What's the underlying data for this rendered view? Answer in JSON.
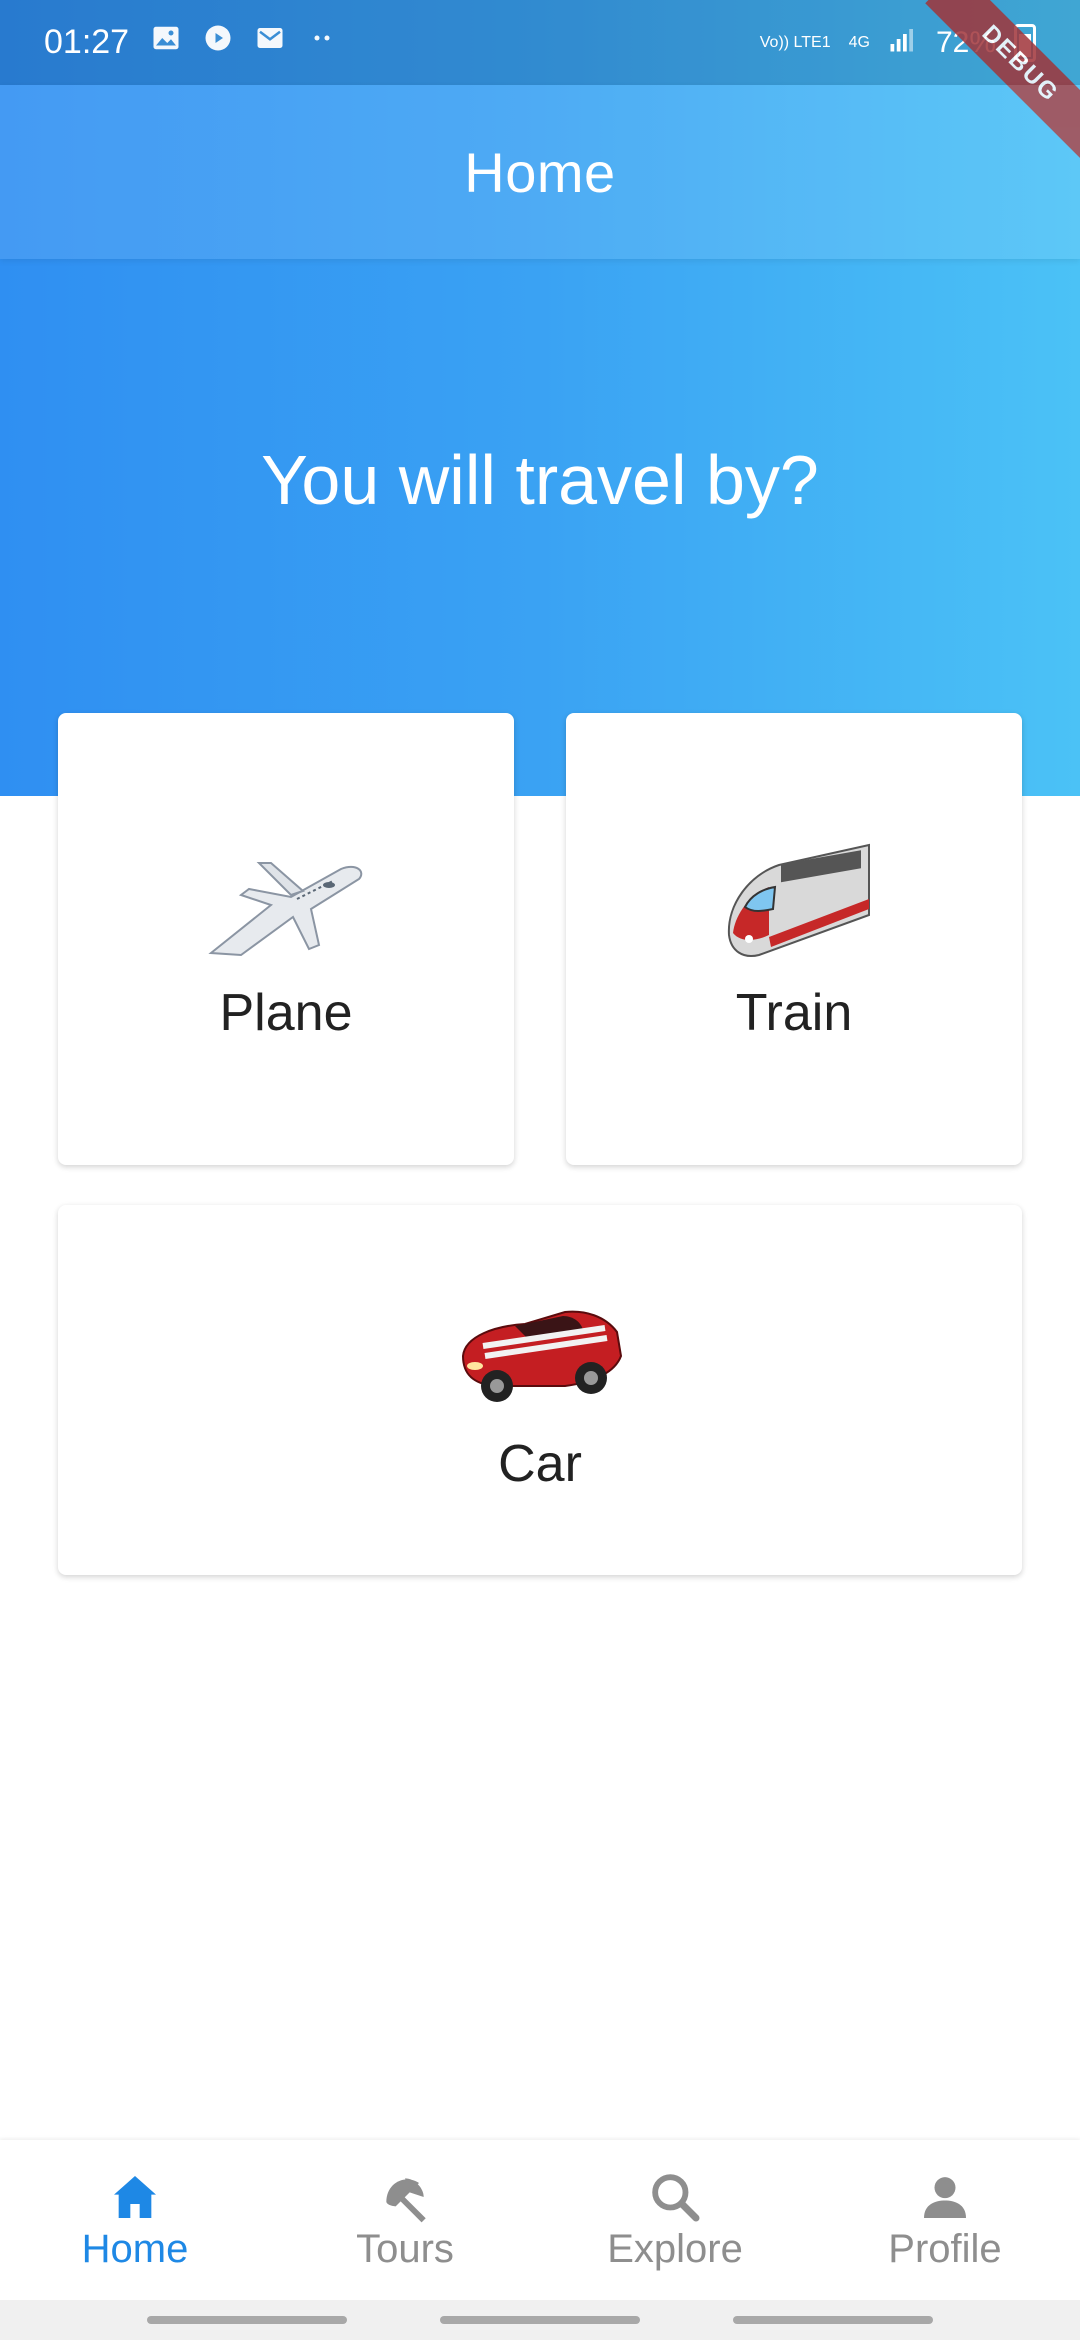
{
  "status_bar": {
    "time": "01:27",
    "left_icons": [
      "image-icon",
      "play-circle-icon",
      "mail-icon",
      "more-dots-icon"
    ],
    "network": "Vo)) LTE1",
    "signal_type": "4G",
    "battery": "72%"
  },
  "debug_banner": "DEBUG",
  "app_bar": {
    "title": "Home"
  },
  "hero": {
    "title": "You will travel by?"
  },
  "options": {
    "plane": {
      "label": "Plane",
      "icon": "plane-icon"
    },
    "train": {
      "label": "Train",
      "icon": "train-icon"
    },
    "car": {
      "label": "Car",
      "icon": "car-icon"
    }
  },
  "bottom_nav": {
    "active": "Home",
    "active_color": "#1e88e5",
    "items": [
      {
        "label": "Home",
        "icon": "home-icon"
      },
      {
        "label": "Tours",
        "icon": "beach-umbrella-icon"
      },
      {
        "label": "Explore",
        "icon": "search-icon"
      },
      {
        "label": "Profile",
        "icon": "person-icon"
      }
    ]
  }
}
